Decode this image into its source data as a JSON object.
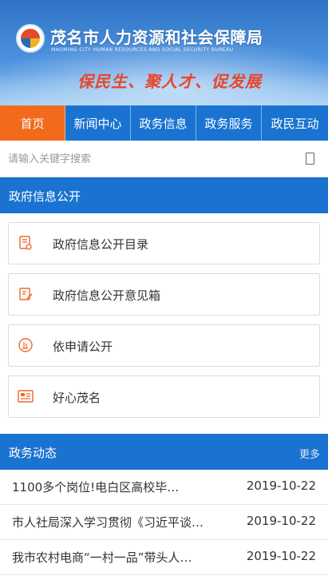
{
  "header": {
    "org_name": "茂名市人力资源和社会保障局",
    "org_name_en": "MAOMING CITY HUMAN RESOURCES AND SOCIAL SECURITY BUREAU",
    "slogan": "保民生、聚人才、促发展"
  },
  "nav": {
    "items": [
      {
        "label": "首页",
        "active": true
      },
      {
        "label": "新闻中心",
        "active": false
      },
      {
        "label": "政务信息",
        "active": false
      },
      {
        "label": "政务服务",
        "active": false
      },
      {
        "label": "政民互动",
        "active": false
      }
    ]
  },
  "search": {
    "placeholder": "请输入关键字搜索"
  },
  "gov_info": {
    "title": "政府信息公开",
    "items": [
      {
        "label": "政府信息公开目录",
        "icon": "document-list-icon"
      },
      {
        "label": "政府信息公开意见箱",
        "icon": "feedback-edit-icon"
      },
      {
        "label": "依申请公开",
        "icon": "apply-circle-icon"
      },
      {
        "label": "好心茂名",
        "icon": "newspaper-icon"
      }
    ]
  },
  "news": {
    "title": "政务动态",
    "more_label": "更多",
    "items": [
      {
        "title": "1100多个岗位!电白区高校毕…",
        "date": "2019-10-22"
      },
      {
        "title": "市人社局深入学习贯彻《习近平谈…",
        "date": "2019-10-22"
      },
      {
        "title": "我市农村电商“一村一品”带头人…",
        "date": "2019-10-22"
      }
    ]
  },
  "colors": {
    "primary_blue": "#1a73d0",
    "active_orange": "#f26b1d",
    "icon_orange": "#ee6a2c"
  }
}
